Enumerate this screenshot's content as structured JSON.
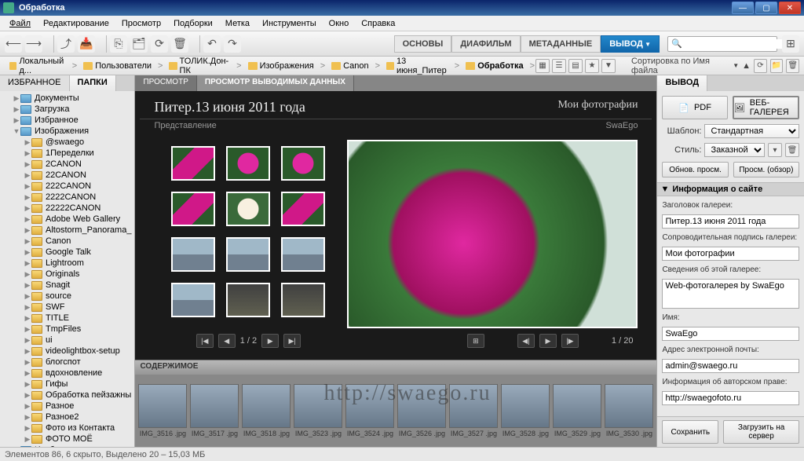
{
  "titlebar": {
    "title": "Обработка"
  },
  "menu": [
    "Файл",
    "Редактирование",
    "Просмотр",
    "Подборки",
    "Метка",
    "Инструменты",
    "Окно",
    "Справка"
  ],
  "workspace_tabs": [
    {
      "label": "ОСНОВЫ",
      "active": false
    },
    {
      "label": "ДИАФИЛЬМ",
      "active": false
    },
    {
      "label": "МЕТАДАННЫЕ",
      "active": false
    },
    {
      "label": "ВЫВОД",
      "active": true
    }
  ],
  "search_placeholder": "",
  "breadcrumb": [
    "Локальный д...",
    "Пользователи",
    "ТОЛИК.Дон-ПК",
    "Изображения",
    "Canon",
    "13 июня_Питер",
    "Обработка"
  ],
  "sort": {
    "label": "Сортировка по Имя файла"
  },
  "left_tabs": [
    {
      "label": "ИЗБРАННОЕ",
      "active": false
    },
    {
      "label": "ПАПКИ",
      "active": true
    }
  ],
  "tree": [
    {
      "label": "Документы",
      "depth": 1,
      "special": true,
      "tri": "▶"
    },
    {
      "label": "Загрузка",
      "depth": 1,
      "special": true,
      "tri": "▶"
    },
    {
      "label": "Избранное",
      "depth": 1,
      "special": true,
      "tri": "▶"
    },
    {
      "label": "Изображения",
      "depth": 1,
      "special": true,
      "tri": "▼"
    },
    {
      "label": "@swaego",
      "depth": 2,
      "tri": "▶"
    },
    {
      "label": "1Переделки",
      "depth": 2,
      "tri": "▶"
    },
    {
      "label": "2CANON",
      "depth": 2,
      "tri": "▶"
    },
    {
      "label": "22CANON",
      "depth": 2,
      "tri": "▶"
    },
    {
      "label": "222CANON",
      "depth": 2,
      "tri": "▶"
    },
    {
      "label": "2222CANON",
      "depth": 2,
      "tri": "▶"
    },
    {
      "label": "22222CANON",
      "depth": 2,
      "tri": "▶"
    },
    {
      "label": "Adobe Web Gallery",
      "depth": 2,
      "tri": "▶"
    },
    {
      "label": "Altostorm_Panorama_",
      "depth": 2,
      "tri": "▶"
    },
    {
      "label": "Canon",
      "depth": 2,
      "tri": "▶"
    },
    {
      "label": "Google Talk",
      "depth": 2,
      "tri": "▶"
    },
    {
      "label": "Lightroom",
      "depth": 2,
      "tri": "▶"
    },
    {
      "label": "Originals",
      "depth": 2,
      "tri": "▶"
    },
    {
      "label": "Snagit",
      "depth": 2,
      "tri": "▶"
    },
    {
      "label": "source",
      "depth": 2,
      "tri": "▶"
    },
    {
      "label": "SWF",
      "depth": 2,
      "tri": "▶"
    },
    {
      "label": "TITLE",
      "depth": 2,
      "tri": "▶"
    },
    {
      "label": "TmpFiles",
      "depth": 2,
      "tri": "▶"
    },
    {
      "label": "ui",
      "depth": 2,
      "tri": "▶"
    },
    {
      "label": "videolightbox-setup",
      "depth": 2,
      "tri": "▶"
    },
    {
      "label": "блогспот",
      "depth": 2,
      "tri": "▶"
    },
    {
      "label": "вдохновление",
      "depth": 2,
      "tri": "▶"
    },
    {
      "label": "Гифы",
      "depth": 2,
      "tri": "▶"
    },
    {
      "label": "Обработка пейзажны",
      "depth": 2,
      "tri": "▶"
    },
    {
      "label": "Разное",
      "depth": 2,
      "tri": "▶"
    },
    {
      "label": "Разное2",
      "depth": 2,
      "tri": "▶"
    },
    {
      "label": "Фото из Контакта",
      "depth": 2,
      "tri": "▶"
    },
    {
      "label": "ФОТО МОЁ",
      "depth": 2,
      "tri": "▶"
    },
    {
      "label": "Изображения",
      "depth": 1,
      "special": true,
      "tri": "▶"
    }
  ],
  "center_tabs": [
    {
      "label": "ПРОСМОТР",
      "active": false
    },
    {
      "label": "ПРОСМОТР ВЫВОДИМЫХ ДАННЫХ",
      "active": true
    }
  ],
  "gallery": {
    "title": "Питер.13 июня 2011 года",
    "caption": "Мои фотографии",
    "sub_left": "Представление",
    "sub_right": "SwaEgo",
    "pager": "1 / 2",
    "counter": "1 / 20"
  },
  "thumbs": [
    "tf-pink1",
    "tf-pink2",
    "tf-pink2",
    "tf-pink1",
    "tf-white",
    "tf-pink1",
    "tf-build",
    "tf-build",
    "tf-build",
    "tf-build",
    "tf-dark",
    "tf-dark"
  ],
  "filmstrip": {
    "header": "СОДЕРЖИМОЕ",
    "items": [
      {
        "name": "IMG_3516 .jpg"
      },
      {
        "name": "IMG_3517 .jpg"
      },
      {
        "name": "IMG_3518 .jpg"
      },
      {
        "name": "IMG_3523 .jpg"
      },
      {
        "name": "IMG_3524 .jpg"
      },
      {
        "name": "IMG_3526 .jpg"
      },
      {
        "name": "IMG_3527 .jpg"
      },
      {
        "name": "IMG_3528 .jpg"
      },
      {
        "name": "IMG_3529 .jpg"
      },
      {
        "name": "IMG_3530 .jpg"
      }
    ],
    "watermark": "http://swaego.ru"
  },
  "right": {
    "tab": "ВЫВОД",
    "pdf": "PDF",
    "webgallery": "ВЕБ-ГАЛЕРЕЯ",
    "template_lbl": "Шаблон:",
    "template_val": "Стандартная",
    "style_lbl": "Стиль:",
    "style_val": "Заказной",
    "refresh": "Обнов. просм.",
    "preview": "Просм. (обзор)",
    "section_info": "Информация о сайте",
    "gal_title_lbl": "Заголовок галереи:",
    "gal_title_val": "Питер.13 июня 2011 года",
    "gal_cap_lbl": "Сопроводительная подпись галереи:",
    "gal_cap_val": "Мои фотографии",
    "about_lbl": "Сведения об этой галерее:",
    "about_val": "Web-фотогалерея by SwaEgo",
    "name_lbl": "Имя:",
    "name_val": "SwaEgo",
    "email_lbl": "Адрес электронной почты:",
    "email_val": "admin@swaego.ru",
    "copy_lbl": "Информация об авторском праве:",
    "copy_val": "http://swaegofoto.ru",
    "save": "Сохранить",
    "upload": "Загрузить на сервер"
  },
  "status": "Элементов 86, 6 скрыто, Выделено 20 – 15,03 MБ"
}
